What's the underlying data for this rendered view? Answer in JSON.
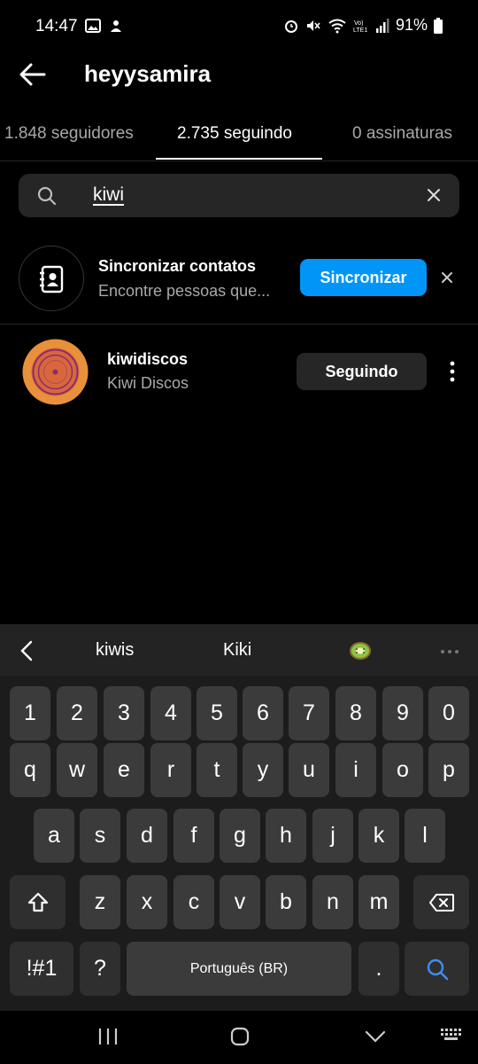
{
  "status_bar": {
    "time": "14:47",
    "battery_text": "91%",
    "icons": [
      "gallery-icon",
      "notification-icon",
      "alarm-icon",
      "mute-icon",
      "wifi-icon",
      "volte-icon",
      "signal-icon",
      "battery-icon"
    ]
  },
  "header": {
    "title": "heyysamira"
  },
  "tabs": [
    {
      "label": "1.848 seguidores"
    },
    {
      "label": "2.735 seguindo"
    },
    {
      "label": "0 assinaturas"
    }
  ],
  "search": {
    "value": "kiwi"
  },
  "sync": {
    "title": "Sincronizar contatos",
    "subtitle": "Encontre pessoas que...",
    "button": "Sincronizar"
  },
  "user": {
    "username": "kiwidiscos",
    "full_name": "Kiwi Discos",
    "button": "Seguindo"
  },
  "keyboard": {
    "suggestions": [
      "kiwis",
      "Kiki"
    ],
    "row_numbers": [
      "1",
      "2",
      "3",
      "4",
      "5",
      "6",
      "7",
      "8",
      "9",
      "0"
    ],
    "row1": [
      "q",
      "w",
      "e",
      "r",
      "t",
      "y",
      "u",
      "i",
      "o",
      "p"
    ],
    "row2": [
      "a",
      "s",
      "d",
      "f",
      "g",
      "h",
      "j",
      "k",
      "l"
    ],
    "row3": [
      "z",
      "x",
      "c",
      "v",
      "b",
      "n",
      "m"
    ],
    "symbols": "!#1",
    "question": "?",
    "space": "Português (BR)",
    "period": "."
  },
  "colors": {
    "accent": "#0095f6",
    "background": "#000000",
    "secondary_text": "#a8a8a8",
    "avatar_orange": "#e8903a"
  }
}
